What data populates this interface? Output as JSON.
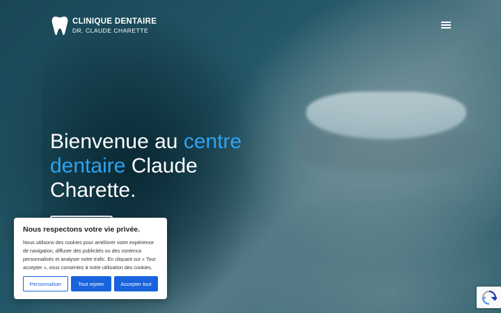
{
  "header": {
    "logo_line1": "CLINIQUE DENTAIRE",
    "logo_line2": "DR. CLAUDE CHARETTE"
  },
  "hero": {
    "headline_part1": "Bienvenue au ",
    "headline_accent": "centre dentaire",
    "headline_part2": " Claude Charette.",
    "accent_color": "#2ea3f2"
  },
  "cookie_banner": {
    "title": "Nous respectons votre vie privée.",
    "body": "Nous utilisons des cookies pour améliorer votre expérience de navigation, diffuser des publicités ou des contenus personnalisés et analyser notre trafic. En cliquant sur « Tout accepter », vous consentez à notre utilisation des cookies.",
    "customize_label": "Personnaliser",
    "reject_label": "Tout rejeter",
    "accept_label": "Accepter tout",
    "button_color": "#1863dc"
  },
  "icons": {
    "logo": "tooth-icon",
    "menu": "hamburger-menu-icon",
    "captcha": "recaptcha-icon"
  }
}
